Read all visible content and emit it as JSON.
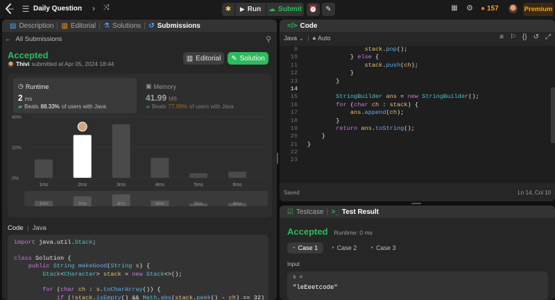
{
  "topbar": {
    "title": "Daily Question",
    "run_label": "Run",
    "submit_label": "Submit",
    "streak_count": "157",
    "premium_label": "Premium",
    "colors": {
      "accent_green": "#2cbb5d",
      "premium": "#ffa116"
    }
  },
  "left": {
    "tabs": [
      "Description",
      "Editorial",
      "Solutions",
      "Submissions"
    ],
    "back_label": "All Submissions",
    "status": "Accepted",
    "user": "Thivi",
    "submitted_text": "submitted at Apr 05, 2024 18:44",
    "editorial_btn": "Editorial",
    "solution_btn": "Solution",
    "runtime": {
      "label": "Runtime",
      "value": "2",
      "unit": "ms",
      "beats_prefix": "Beats",
      "beats_pct": "88.33%",
      "beats_suffix": "of users with Java"
    },
    "memory": {
      "label": "Memory",
      "value": "41.99",
      "unit": "MB",
      "beats_prefix": "Beats",
      "beats_pct": "77.06%",
      "beats_suffix": "of users with Java"
    },
    "code_header": {
      "code": "Code",
      "lang": "Java"
    },
    "code_lines": [
      "import java.util.Stack;",
      "",
      "class Solution {",
      "    public String makeGood(String s) {",
      "        Stack<Character> stack = new Stack<>();",
      "",
      "        for (char ch : s.toCharArray()) {",
      "            if (!stack.isEmpty() && Math.abs(stack.peek() - ch) == 32) {"
    ]
  },
  "chart_data": {
    "type": "bar",
    "categories": [
      "1ms",
      "2ms",
      "3ms",
      "4ms",
      "5ms",
      "6ms"
    ],
    "values": [
      12,
      28,
      35,
      13,
      3,
      4
    ],
    "highlight_index": 1,
    "yticks": [
      "40%",
      "20%",
      "0%"
    ],
    "ylim": [
      0,
      40
    ],
    "colors": {
      "bar": "#4a4a4a",
      "highlight": "#ffffff"
    }
  },
  "right": {
    "code_tab": "Code",
    "lang": "Java",
    "auto_label": "Auto",
    "line_numbers": [
      "9",
      "10",
      "11",
      "12",
      "13",
      "14",
      "15",
      "16",
      "17",
      "18",
      "19",
      "20",
      "21",
      "22",
      "23"
    ],
    "code_lines": [
      "                stack.pop();",
      "            } else {",
      "                stack.push(ch);",
      "            }",
      "        }",
      "",
      "        StringBuilder ans = new StringBuilder();",
      "        for (char ch : stack) {",
      "            ans.append(ch);",
      "        }",
      "        return ans.toString();",
      "    }",
      "}",
      ""
    ],
    "saved_label": "Saved",
    "cursor_pos": "Ln 14, Col 10",
    "testcase_tab": "Testcase",
    "result_tab": "Test Result",
    "result_status": "Accepted",
    "runtime_text": "Runtime: 0 ms",
    "cases": [
      "Case 1",
      "Case 2",
      "Case 3"
    ],
    "input_label": "Input",
    "var_name": "s =",
    "var_value": "\"leEeetcode\""
  }
}
